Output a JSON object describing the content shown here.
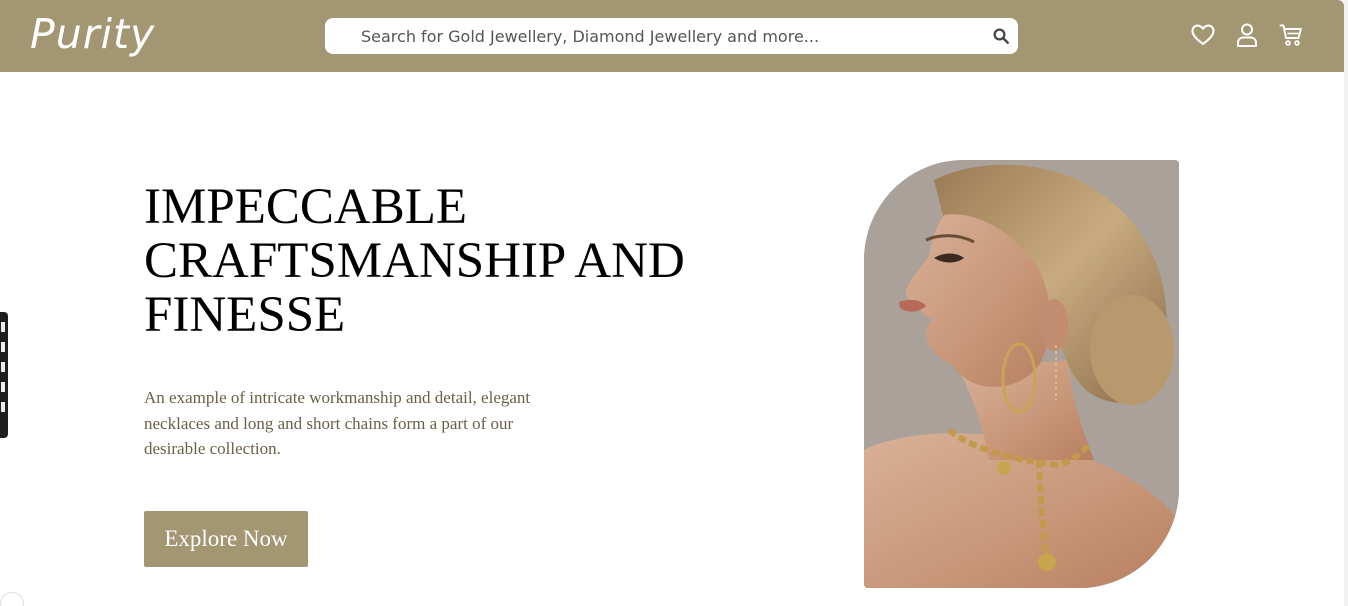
{
  "brand": {
    "logo_text": "Purity"
  },
  "search": {
    "placeholder": "Search for Gold Jewellery, Diamond Jewellery and more...",
    "icon": "search-icon"
  },
  "header_icons": [
    "heart-icon",
    "user-icon",
    "cart-icon"
  ],
  "hero": {
    "headline_lines": [
      "IMPECCABLE",
      "CRAFTSMANSHIP AND",
      "FINESSE"
    ],
    "description": "An example of intricate workmanship and detail, elegant necklaces and long and short chains form a part of our desirable collection.",
    "cta_label": "Explore Now"
  },
  "colors": {
    "brand": "#a39673",
    "text_primary": "#000000",
    "text_secondary": "#6b5f48",
    "background": "#ffffff"
  }
}
